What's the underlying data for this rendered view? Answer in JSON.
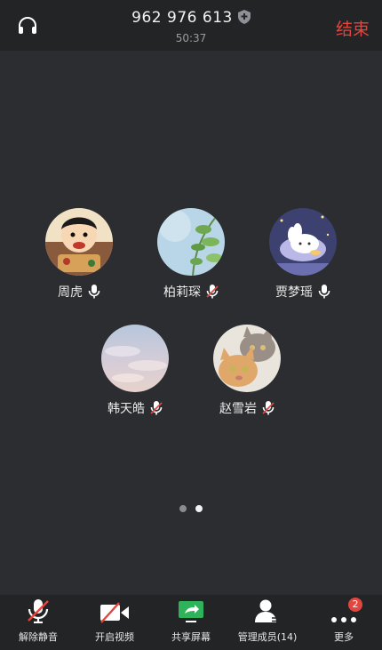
{
  "header": {
    "meeting_id": "962 976 613",
    "duration": "50:37",
    "end_label": "结束"
  },
  "participants": [
    {
      "name": "周虎",
      "mic": "on"
    },
    {
      "name": "柏莉琛",
      "mic": "muted"
    },
    {
      "name": "贾梦瑶",
      "mic": "on"
    },
    {
      "name": "韩天皓",
      "mic": "muted"
    },
    {
      "name": "赵雪岩",
      "mic": "muted"
    }
  ],
  "pager": {
    "pages": 2,
    "current": 2
  },
  "toolbar": {
    "unmute_label": "解除静音",
    "video_label": "开启视频",
    "share_label": "共享屏幕",
    "members_label": "管理成员(14)",
    "more_label": "更多",
    "more_badge": "2"
  },
  "colors": {
    "accent_red": "#e2463f",
    "share_green": "#2fb35a",
    "background": "#2b2d30",
    "bar": "#232426"
  }
}
